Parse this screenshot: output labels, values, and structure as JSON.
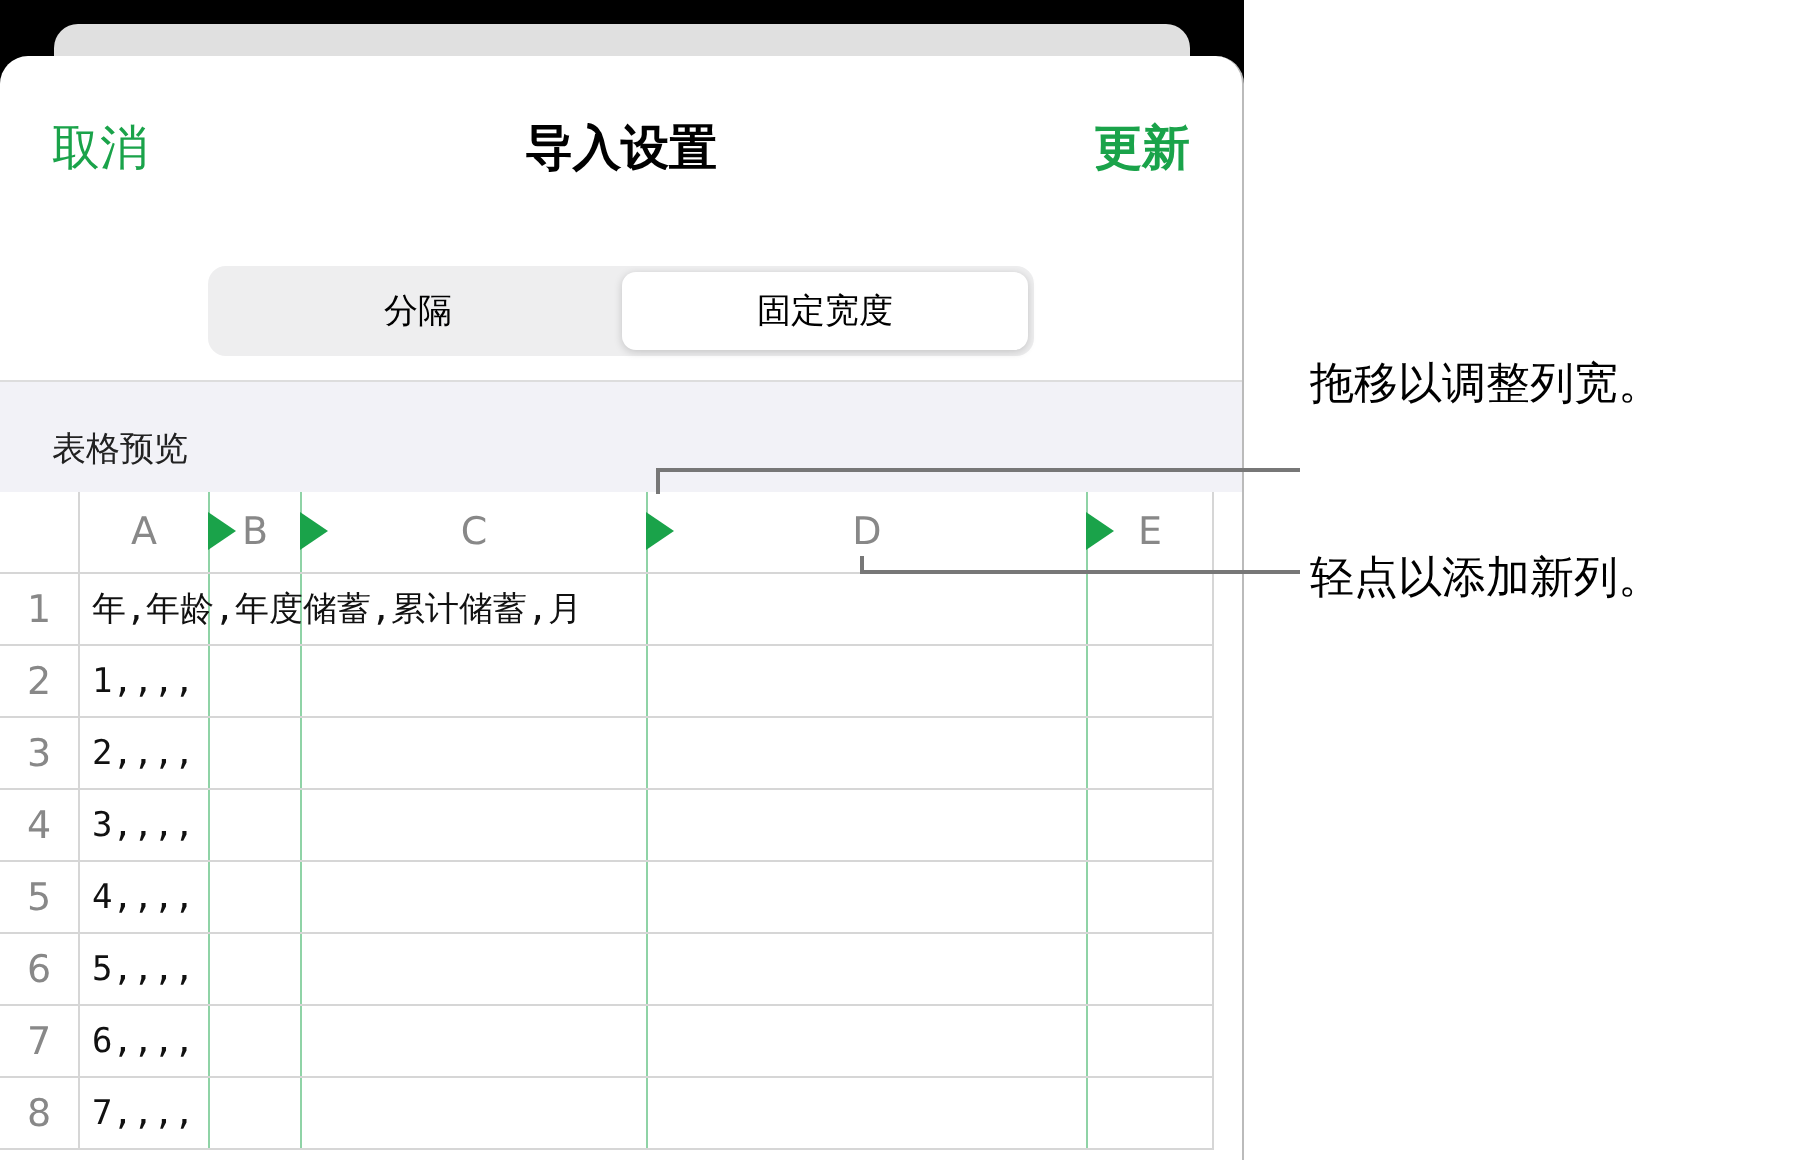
{
  "header": {
    "cancel": "取消",
    "title": "导入设置",
    "update": "更新"
  },
  "segments": [
    {
      "label": "分隔",
      "selected": false
    },
    {
      "label": "固定宽度",
      "selected": true
    }
  ],
  "section_label": "表格预览",
  "table": {
    "columns": [
      "A",
      "B",
      "C",
      "D",
      "E"
    ],
    "rows": [
      {
        "number": "1",
        "value": "年,年龄,年度储蓄,累计储蓄,月"
      },
      {
        "number": "2",
        "value": "1,,,,"
      },
      {
        "number": "3",
        "value": "2,,,,"
      },
      {
        "number": "4",
        "value": "3,,,,"
      },
      {
        "number": "5",
        "value": "4,,,,"
      },
      {
        "number": "6",
        "value": "5,,,,"
      },
      {
        "number": "7",
        "value": "6,,,,"
      },
      {
        "number": "8",
        "value": "7,,,,"
      }
    ]
  },
  "callouts": [
    "拖移以调整列宽。",
    "轻点以添加新列。"
  ]
}
